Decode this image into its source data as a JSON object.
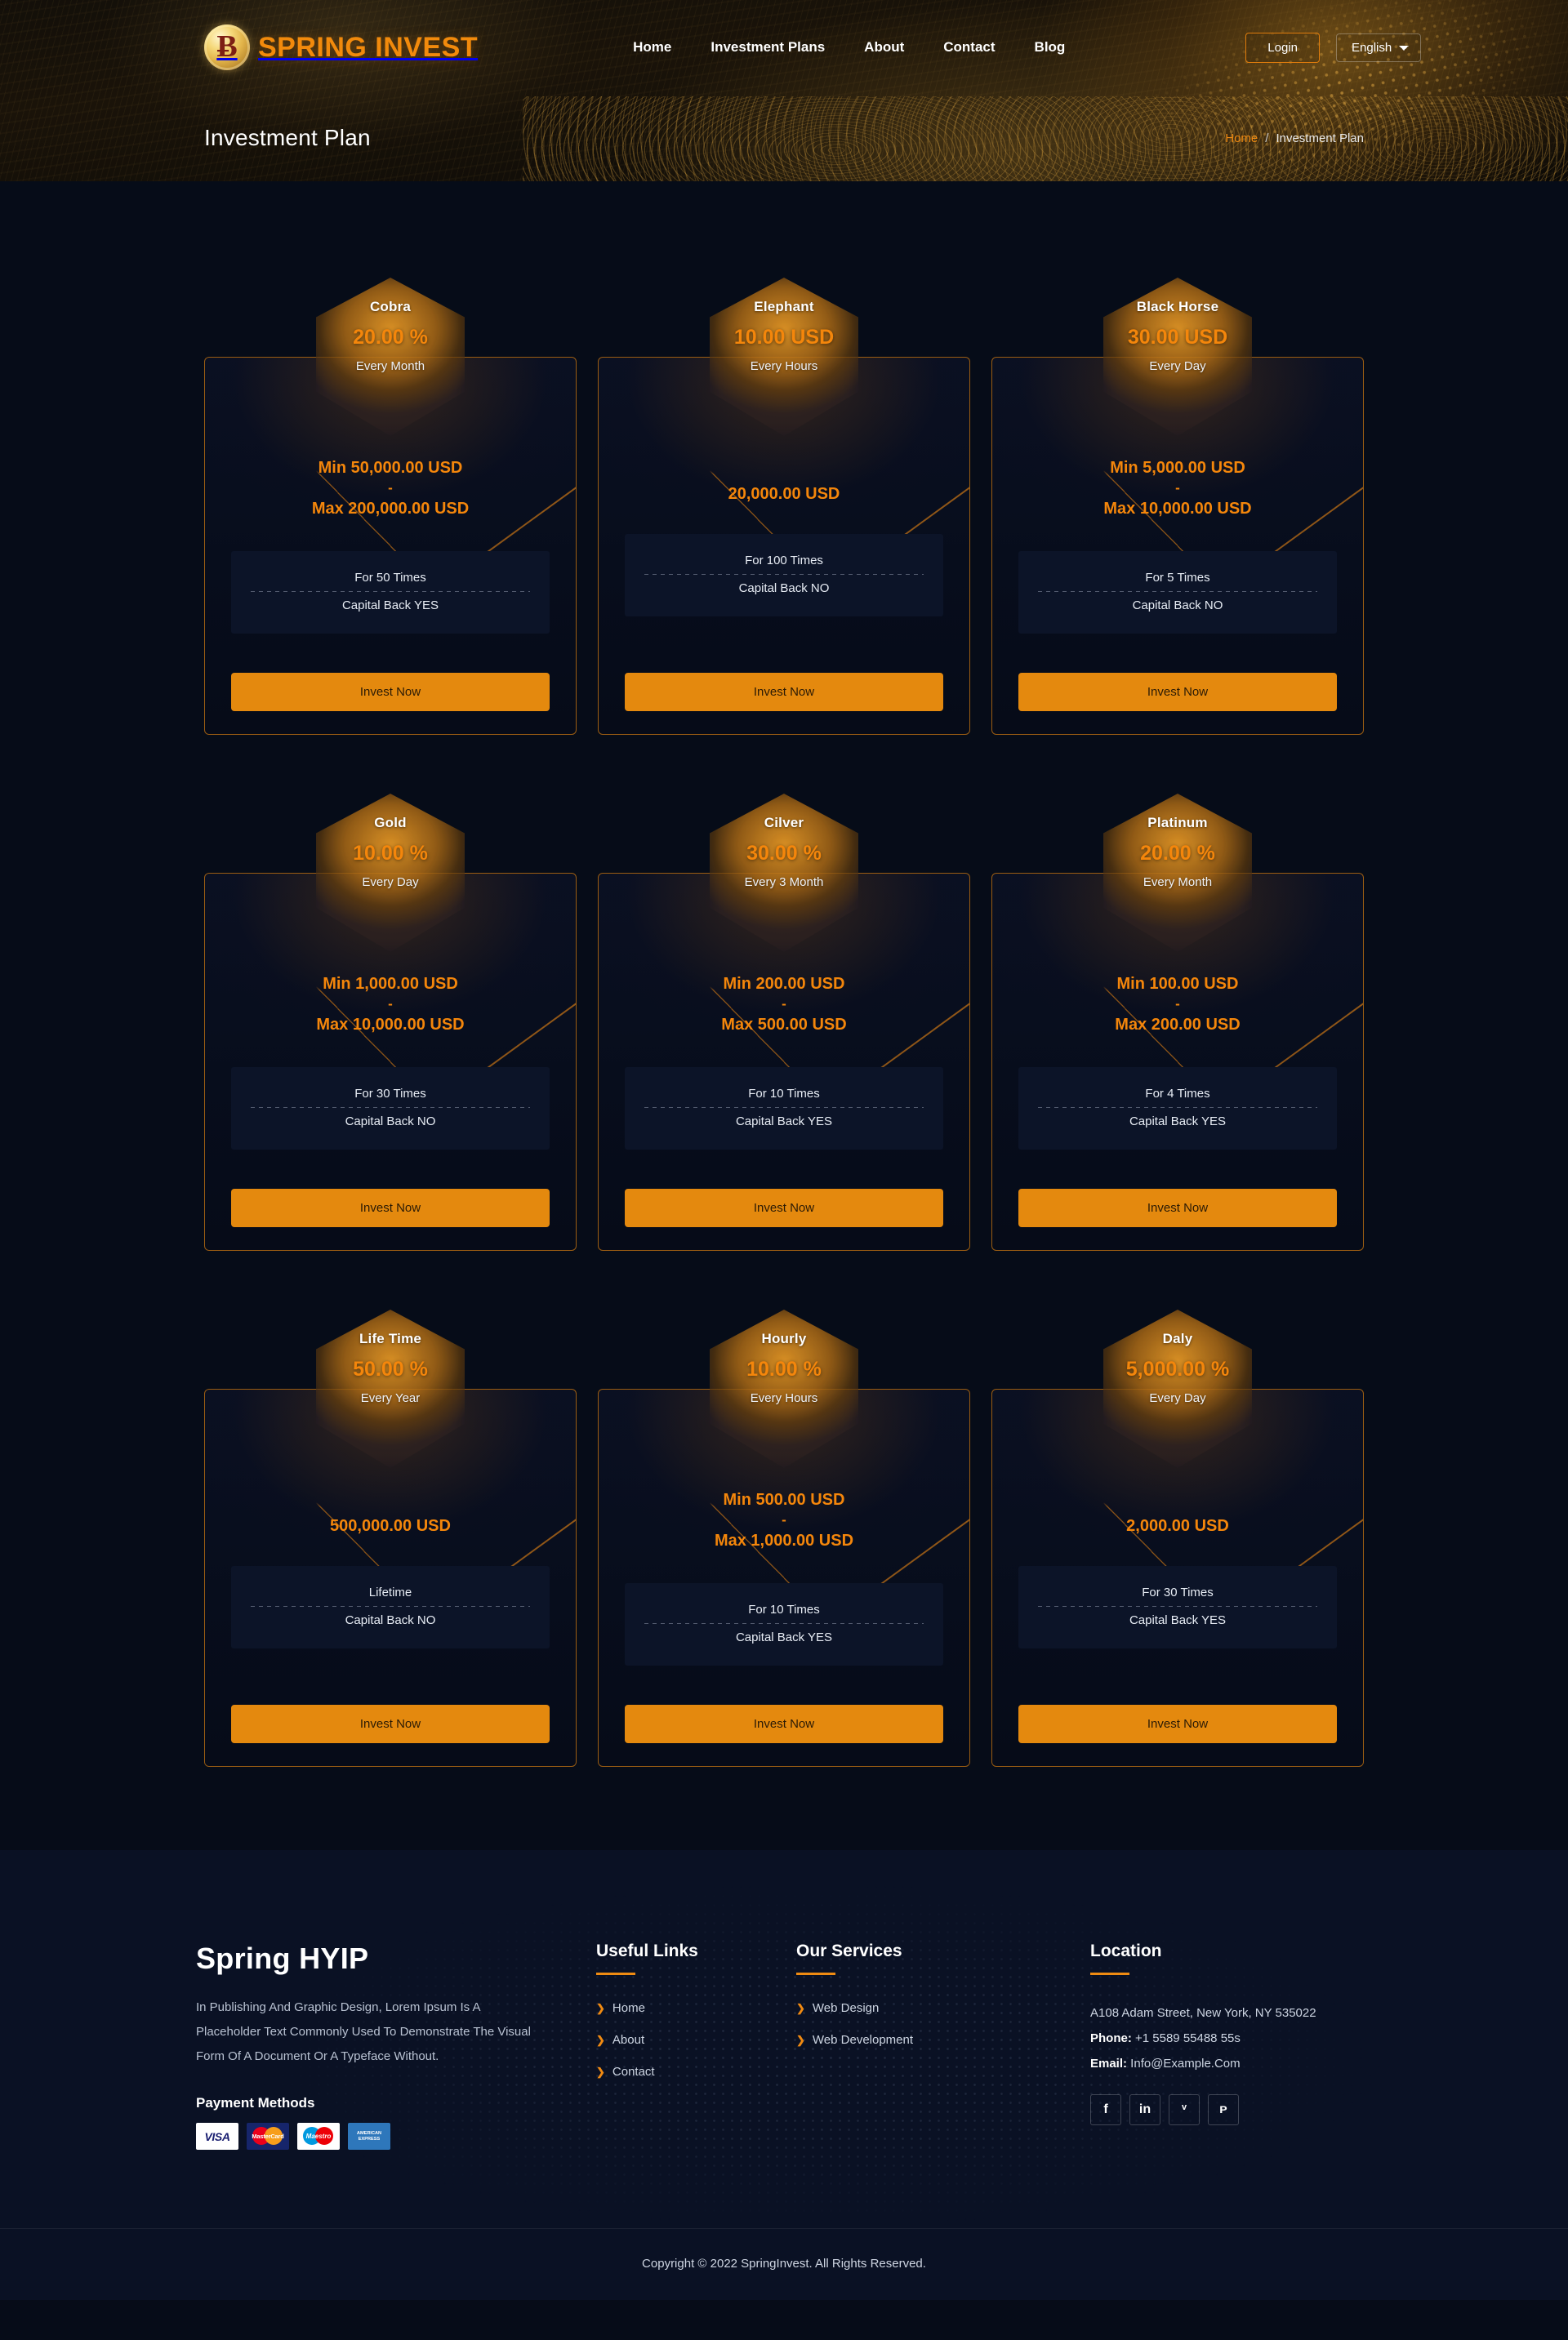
{
  "header": {
    "brand": {
      "name": "SPRING INVEST",
      "icon": "bitcoin-coin-icon",
      "glyph": "Ƀ"
    },
    "nav": [
      {
        "label": "Home"
      },
      {
        "label": "Investment Plans"
      },
      {
        "label": "About"
      },
      {
        "label": "Contact"
      },
      {
        "label": "Blog"
      }
    ],
    "login_label": "Login",
    "language": {
      "selected": "English",
      "options": [
        "English"
      ]
    },
    "page_title": "Investment Plan",
    "breadcrumb": {
      "home": "Home",
      "separator": "/",
      "current": "Investment Plan"
    }
  },
  "plans": [
    {
      "name": "Cobra",
      "value": "20.00 %",
      "period": "Every Month",
      "min": "Min 50,000.00 USD",
      "dash": "-",
      "max": "Max 200,000.00 USD",
      "times": "For 50 Times",
      "capital": "Capital Back YES",
      "cta": "Invest Now"
    },
    {
      "name": "Elephant",
      "value": "10.00 USD",
      "period": "Every Hours",
      "amount": "20,000.00 USD",
      "times": "For 100 Times",
      "capital": "Capital Back NO",
      "cta": "Invest Now"
    },
    {
      "name": "Black Horse",
      "value": "30.00 USD",
      "period": "Every Day",
      "min": "Min 5,000.00 USD",
      "dash": "-",
      "max": "Max 10,000.00 USD",
      "times": "For 5 Times",
      "capital": "Capital Back NO",
      "cta": "Invest Now"
    },
    {
      "name": "Gold",
      "value": "10.00 %",
      "period": "Every Day",
      "min": "Min 1,000.00 USD",
      "dash": "-",
      "max": "Max 10,000.00 USD",
      "times": "For 30 Times",
      "capital": "Capital Back NO",
      "cta": "Invest Now"
    },
    {
      "name": "Cilver",
      "value": "30.00 %",
      "period": "Every 3 Month",
      "min": "Min 200.00 USD",
      "dash": "-",
      "max": "Max 500.00 USD",
      "times": "For 10 Times",
      "capital": "Capital Back YES",
      "cta": "Invest Now"
    },
    {
      "name": "Platinum",
      "value": "20.00 %",
      "period": "Every Month",
      "min": "Min 100.00 USD",
      "dash": "-",
      "max": "Max 200.00 USD",
      "times": "For 4 Times",
      "capital": "Capital Back YES",
      "cta": "Invest Now"
    },
    {
      "name": "Life Time",
      "value": "50.00 %",
      "period": "Every Year",
      "amount": "500,000.00 USD",
      "times": "Lifetime",
      "capital": "Capital Back NO",
      "cta": "Invest Now"
    },
    {
      "name": "Hourly",
      "value": "10.00 %",
      "period": "Every Hours",
      "min": "Min 500.00 USD",
      "dash": "-",
      "max": "Max 1,000.00 USD",
      "times": "For 10 Times",
      "capital": "Capital Back YES",
      "cta": "Invest Now"
    },
    {
      "name": "Daly",
      "value": "5,000.00 %",
      "period": "Every Day",
      "amount": "2,000.00 USD",
      "times": "For 30 Times",
      "capital": "Capital Back YES",
      "cta": "Invest Now"
    }
  ],
  "footer": {
    "brand": "Spring HYIP",
    "description": "In Publishing And Graphic Design, Lorem Ipsum Is A Placeholder Text Commonly Used To Demonstrate The Visual Form Of A Document Or A Typeface Without.",
    "payment_title": "Payment Methods",
    "payment_methods": [
      {
        "name": "VISA",
        "icon": "visa-icon"
      },
      {
        "name": "MasterCard",
        "icon": "mastercard-icon"
      },
      {
        "name": "Maestro",
        "icon": "maestro-icon"
      },
      {
        "name": "AMERICAN EXPRESS",
        "icon": "amex-icon"
      }
    ],
    "useful_links": {
      "title": "Useful Links",
      "items": [
        "Home",
        "About",
        "Contact"
      ]
    },
    "services": {
      "title": "Our Services",
      "items": [
        "Web Design",
        "Web Development"
      ]
    },
    "location": {
      "title": "Location",
      "address": "A108 Adam Street, New York, NY 535022",
      "phone_label": "Phone:",
      "phone": " +1 5589 55488 55s",
      "email_label": "Email:",
      "email": " Info@Example.Com"
    },
    "socials": [
      {
        "name": "facebook",
        "glyph": "f"
      },
      {
        "name": "linkedin",
        "glyph": "in"
      },
      {
        "name": "twitter",
        "glyph": "ᵛ"
      },
      {
        "name": "pinterest",
        "glyph": "ᴘ"
      }
    ],
    "copyright": "Copyright © 2022 SpringInvest. All Rights Reserved."
  },
  "colors": {
    "accent": "#ef8b12",
    "accent_dark": "#e4890e",
    "bg": "#060c18",
    "footer_bg": "#0a1124"
  }
}
